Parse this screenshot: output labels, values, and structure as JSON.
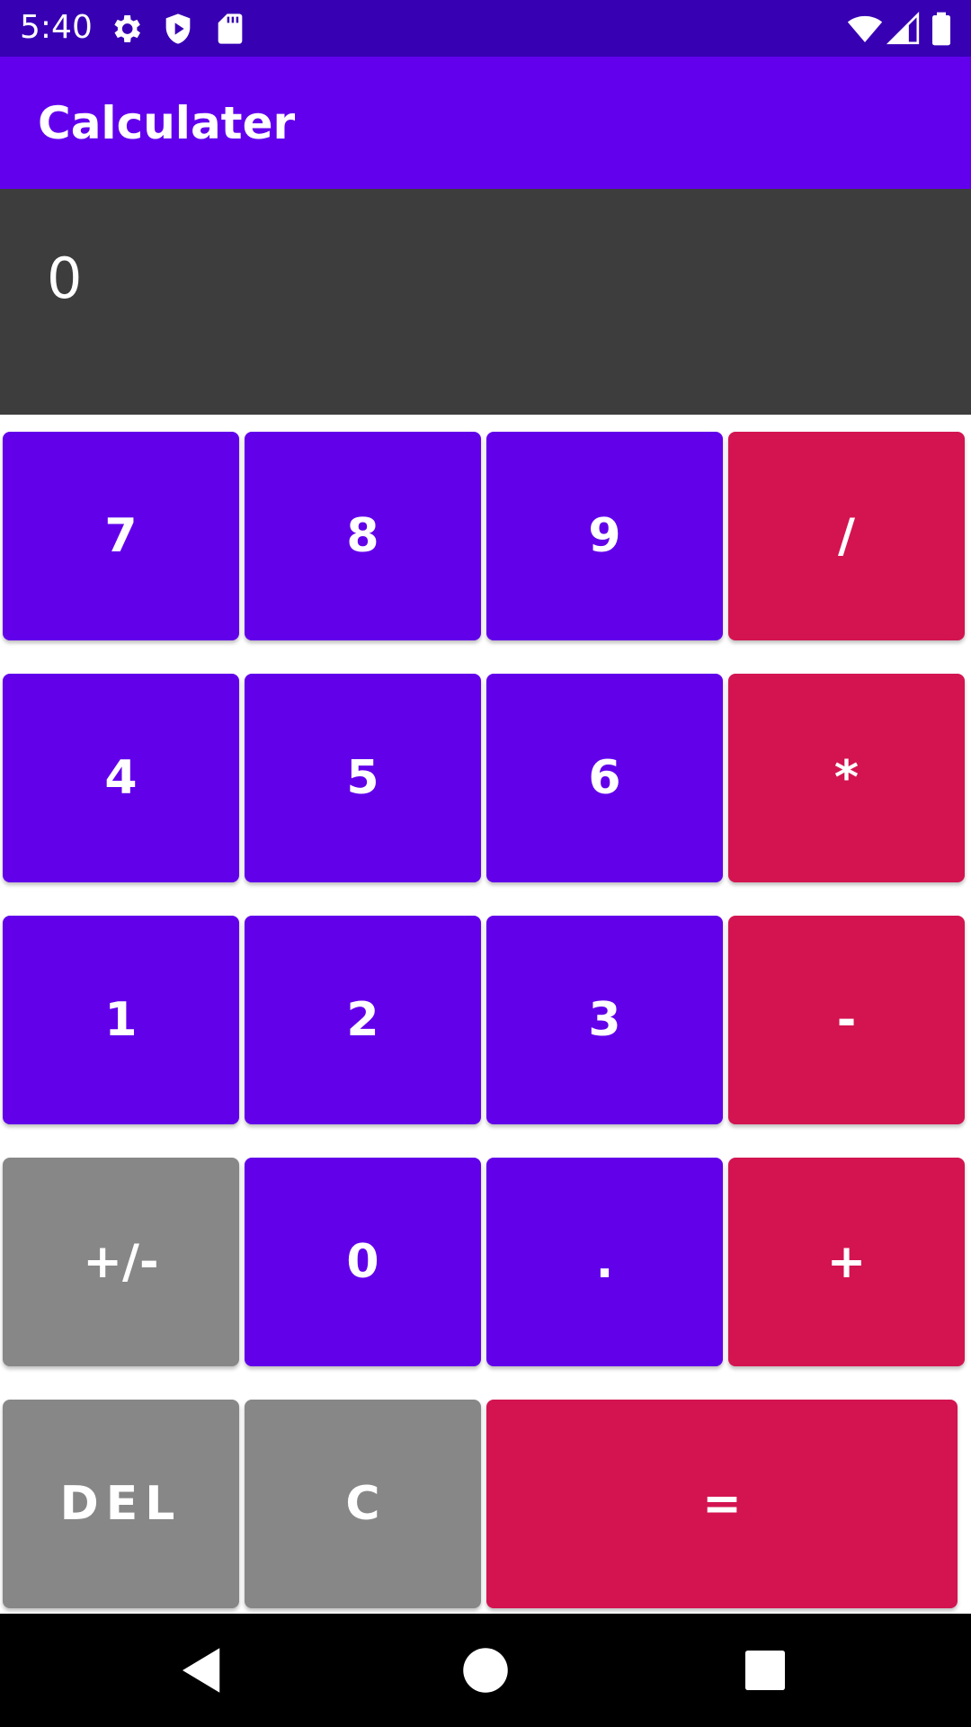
{
  "status_bar": {
    "time": "5:40",
    "icons_left": [
      "gear-icon",
      "play-protect-icon",
      "sd-card-icon"
    ],
    "icons_right": [
      "wifi-icon",
      "cell-signal-icon",
      "battery-icon"
    ]
  },
  "app_bar": {
    "title": "Calculater"
  },
  "display": {
    "value": "0"
  },
  "keys": [
    {
      "label": "7",
      "type": "num"
    },
    {
      "label": "8",
      "type": "num"
    },
    {
      "label": "9",
      "type": "num"
    },
    {
      "label": "/",
      "type": "op"
    },
    {
      "label": "4",
      "type": "num"
    },
    {
      "label": "5",
      "type": "num"
    },
    {
      "label": "6",
      "type": "num"
    },
    {
      "label": "*",
      "type": "op"
    },
    {
      "label": "1",
      "type": "num"
    },
    {
      "label": "2",
      "type": "num"
    },
    {
      "label": "3",
      "type": "num"
    },
    {
      "label": "-",
      "type": "op"
    },
    {
      "label": "+/-",
      "type": "fn"
    },
    {
      "label": "0",
      "type": "num"
    },
    {
      "label": ".",
      "type": "num"
    },
    {
      "label": "+",
      "type": "op"
    },
    {
      "label": "DEL",
      "type": "fn"
    },
    {
      "label": "C",
      "type": "fn"
    },
    {
      "label": "=",
      "type": "op"
    }
  ],
  "colors": {
    "status_bar": "#3700b3",
    "app_bar": "#6200ee",
    "display_bg": "#3d3d3d",
    "number_key": "#6200ea",
    "operator_key": "#d31451",
    "function_key": "#878787",
    "nav_bar": "#000000"
  },
  "nav_bar": {
    "buttons": [
      "back-icon",
      "home-icon",
      "recents-icon"
    ]
  }
}
